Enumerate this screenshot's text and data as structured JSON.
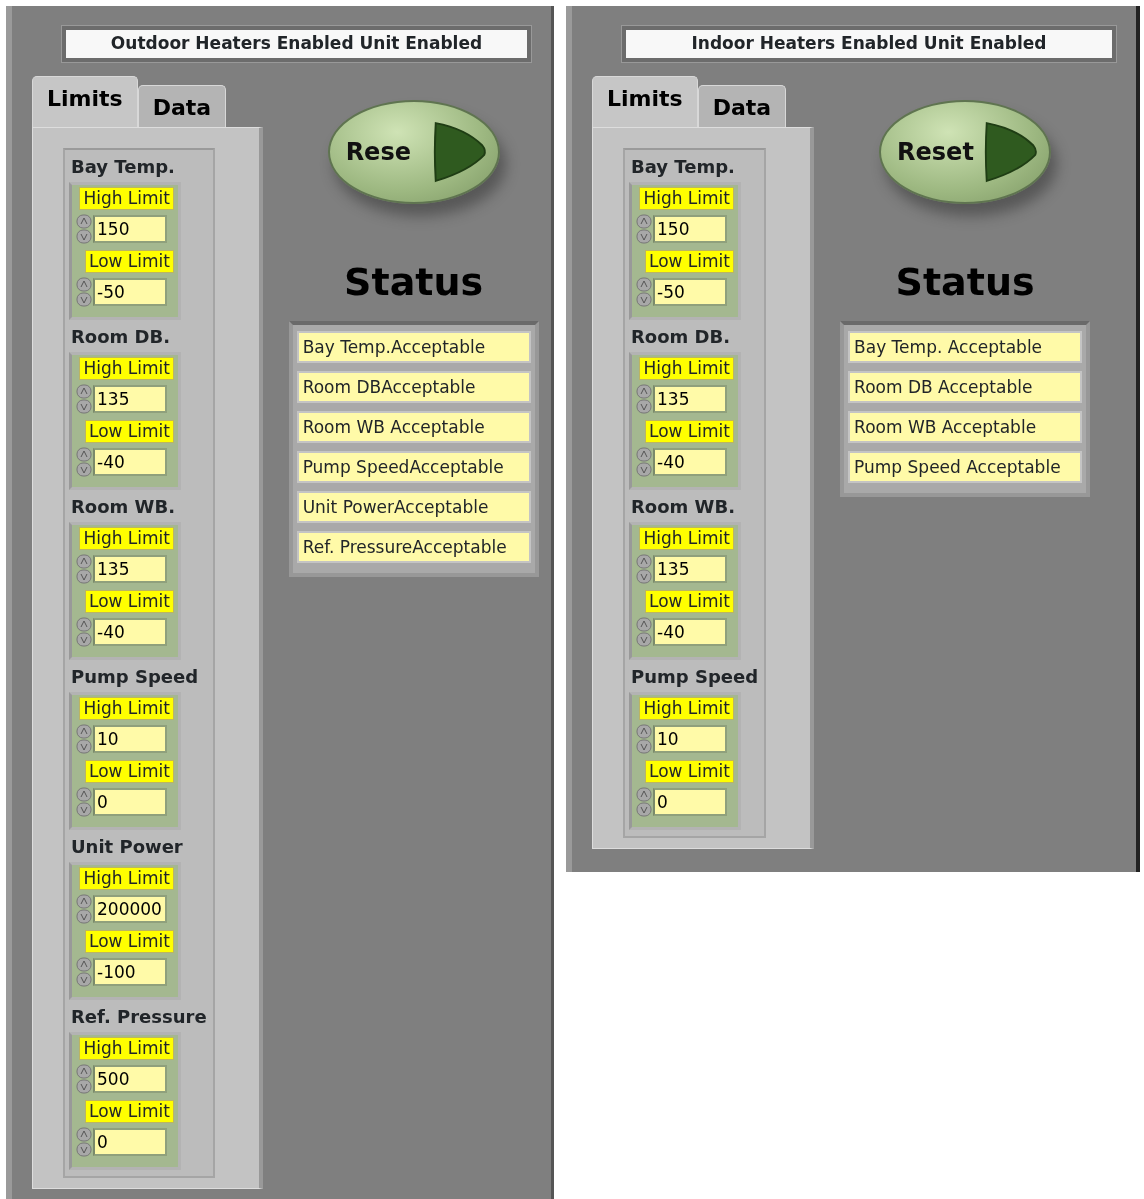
{
  "panels": [
    {
      "title": "Outdoor Heaters Enabled Unit Enabled",
      "tabs": [
        {
          "label": "Limits",
          "selected": true
        },
        {
          "label": "Data",
          "selected": false
        }
      ],
      "reset_button": {
        "label": "Rese"
      },
      "status_heading": "Status",
      "limits": [
        {
          "name": "Bay Temp.",
          "high_label": "High Limit",
          "high": "150",
          "low_label": "Low Limit",
          "low": "-50"
        },
        {
          "name": "Room DB.",
          "high_label": "High Limit",
          "high": "135",
          "low_label": "Low Limit",
          "low": "-40"
        },
        {
          "name": "Room WB.",
          "high_label": "High Limit",
          "high": "135",
          "low_label": "Low Limit",
          "low": "-40"
        },
        {
          "name": "Pump Speed",
          "high_label": "High Limit",
          "high": "10",
          "low_label": "Low Limit",
          "low": "0"
        },
        {
          "name": "Unit Power",
          "high_label": "High Limit",
          "high": "200000",
          "low_label": "Low Limit",
          "low": "-100"
        },
        {
          "name": "Ref. Pressure",
          "high_label": "High Limit",
          "high": "500",
          "low_label": "Low Limit",
          "low": "0"
        }
      ],
      "status_items": [
        "Bay Temp.Acceptable",
        "Room DBAcceptable",
        "Room WB Acceptable",
        "Pump SpeedAcceptable",
        "Unit PowerAcceptable",
        "Ref. PressureAcceptable"
      ]
    },
    {
      "title": "Indoor Heaters Enabled Unit Enabled",
      "tabs": [
        {
          "label": "Limits",
          "selected": true
        },
        {
          "label": "Data",
          "selected": false
        }
      ],
      "reset_button": {
        "label": "Reset"
      },
      "status_heading": "Status",
      "limits": [
        {
          "name": "Bay Temp.",
          "high_label": "High Limit",
          "high": "150",
          "low_label": "Low Limit",
          "low": "-50"
        },
        {
          "name": "Room DB.",
          "high_label": "High Limit",
          "high": "135",
          "low_label": "Low Limit",
          "low": "-40"
        },
        {
          "name": "Room WB.",
          "high_label": "High Limit",
          "high": "135",
          "low_label": "Low Limit",
          "low": "-40"
        },
        {
          "name": "Pump Speed",
          "high_label": "High Limit",
          "high": "10",
          "low_label": "Low Limit",
          "low": "0"
        }
      ],
      "status_items": [
        "Bay Temp. Acceptable",
        "Room DB Acceptable",
        "Room WB Acceptable",
        "Pump Speed Acceptable"
      ]
    }
  ]
}
